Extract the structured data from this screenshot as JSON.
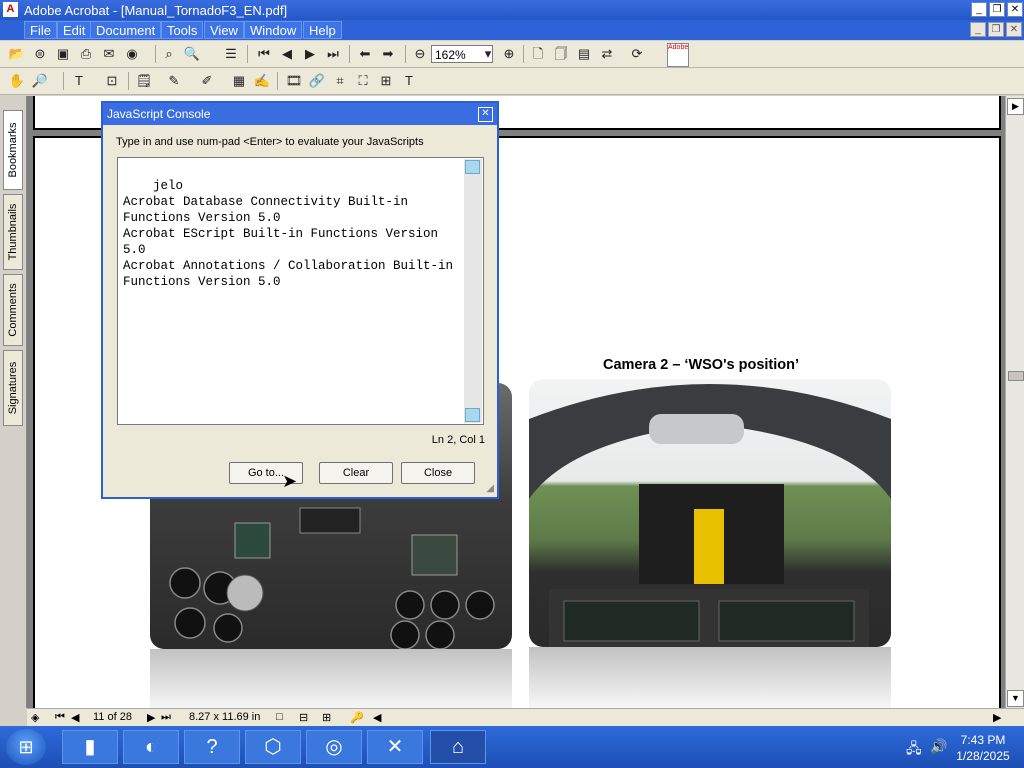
{
  "window": {
    "title": "Adobe Acrobat - [Manual_TornadoF3_EN.pdf]",
    "app_icon_label": "A",
    "controls": [
      "_",
      "❐",
      "✕"
    ]
  },
  "menu": {
    "items": [
      "File",
      "Edit",
      "Document",
      "Tools",
      "View",
      "Window",
      "Help"
    ],
    "doc_controls": [
      "_",
      "❐",
      "✕"
    ]
  },
  "toolbar": {
    "zoom_value": "162%",
    "adobe_logo": "Adobe"
  },
  "left_tabs": [
    "Bookmarks",
    "Thumbnails",
    "Comments",
    "Signatures"
  ],
  "document": {
    "camera_caption": "Camera 2 – ‘WSO's position’"
  },
  "status_bar": {
    "page_display": "11 of 28",
    "page_size": "8.27 x 11.69 in"
  },
  "js_console": {
    "title": "JavaScript Console",
    "instructions": "Type in and use num-pad <Enter> to evaluate your JavaScripts",
    "console_text": "jelo\nAcrobat Database Connectivity Built-in Functions Version 5.0\nAcrobat EScript Built-in Functions Version 5.0\nAcrobat Annotations / Collaboration Built-in Functions Version 5.0",
    "position": "Ln 2, Col 1",
    "goto_label": "Go to...",
    "clear_label": "Clear",
    "close_label": "Close"
  },
  "taskbar": {
    "time": "7:43 PM",
    "date": "1/28/2025"
  },
  "colors": {
    "titlebar": "#2457c8",
    "menubar": "#2d63d6",
    "dialog_border": "#2d5fd4"
  },
  "icons": [
    "open-icon",
    "save-icon",
    "print-icon",
    "email-icon",
    "search-icon",
    "first-page-icon",
    "prev-page-icon",
    "next-page-icon",
    "last-page-icon",
    "zoom-out-icon",
    "zoom-in-icon",
    "hand-tool-icon",
    "zoom-tool-icon"
  ]
}
